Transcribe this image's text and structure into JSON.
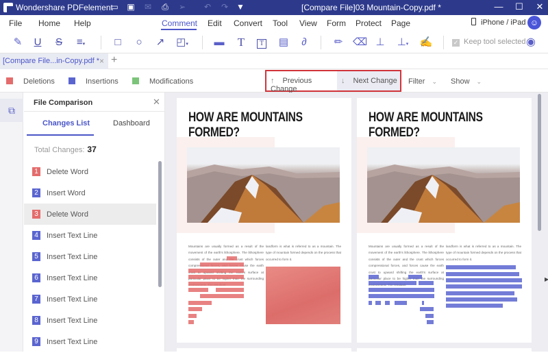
{
  "titlebar": {
    "app_name": "Wondershare PDFelement",
    "document_title": "[Compare File]03 Mountain-Copy.pdf *",
    "quick_access": [
      "open-folder-icon",
      "save-icon",
      "email-icon",
      "print-icon",
      "share-icon",
      "undo-icon",
      "redo-icon",
      "customize-icon"
    ],
    "window_controls": {
      "minimize": "—",
      "maximize": "☐",
      "close": "✕"
    }
  },
  "menu": {
    "items": [
      "File",
      "Home",
      "Help",
      "Comment",
      "Edit",
      "Convert",
      "Tool",
      "View",
      "Form",
      "Protect",
      "Page"
    ],
    "active": "Comment",
    "device_label": "iPhone / iPad",
    "avatar_glyph": "☺"
  },
  "toolbar": {
    "keep_tool_label": "Keep tool selected",
    "keep_tool_checked": true
  },
  "tabs": {
    "active_label": "[Compare File...in-Copy.pdf *",
    "close_glyph": "×",
    "add_glyph": "+"
  },
  "legend": {
    "items": [
      {
        "label": "Deletions",
        "color": "#e46c6c"
      },
      {
        "label": "Insertions",
        "color": "#5b65d0"
      },
      {
        "label": "Modifications",
        "color": "#7cc47a"
      }
    ]
  },
  "navigation": {
    "previous_label": "Previous Change",
    "next_label": "Next Change",
    "filter_label": "Filter",
    "show_label": "Show",
    "highlight_color": "#d0333a"
  },
  "panel": {
    "title": "File Comparison",
    "tabs": [
      "Changes List",
      "Dashboard"
    ],
    "active_tab": "Changes List",
    "total_label": "Total Changes:",
    "total_value": "37",
    "selected_index": 3,
    "changes": [
      {
        "num": "1",
        "label": "Delete Word",
        "type": "deletion"
      },
      {
        "num": "2",
        "label": "Insert Word",
        "type": "insertion"
      },
      {
        "num": "3",
        "label": "Delete Word",
        "type": "deletion"
      },
      {
        "num": "4",
        "label": "Insert Text Line",
        "type": "insertion"
      },
      {
        "num": "5",
        "label": "Insert Text Line",
        "type": "insertion"
      },
      {
        "num": "6",
        "label": "Insert Text Line",
        "type": "insertion"
      },
      {
        "num": "7",
        "label": "Insert Text Line",
        "type": "insertion"
      },
      {
        "num": "8",
        "label": "Insert Text Line",
        "type": "insertion"
      },
      {
        "num": "9",
        "label": "Insert Text Line",
        "type": "insertion"
      }
    ],
    "colors": {
      "deletion": "#e46c6c",
      "insertion": "#5b65d0"
    }
  },
  "documents": {
    "original": {
      "title": "HOW ARE MOUNTAINS FORMED?",
      "col1": "Mountains are usually formed as a result of the movement of the earth's lithosphere. The lithosphere consists of the outer and the crust which forces compressional forces, and forces cause the earth crust to upward shifting the earth's surface at particular place to be higher than the surrounding environment. The resultant",
      "col2": "landform is what is referred to as a mountain. The type of mountain formed depends on the process that occurred to form it."
    },
    "modified": {
      "title": "HOW ARE MOUNTAINS FORMED?",
      "col1": "Mountains are usually formed as a result of the movement of the earth's lithosphere. The lithosphere consists of the outer and the crust which forces compressional forces, and forces cause the earth crust to upward shifting the earth's surface at particular place to be higher than the surrounding environment. The resultant",
      "col2": "landform is what is referred to as a mountain. The type of mountain formed depends on the process that occurred to form it."
    }
  }
}
